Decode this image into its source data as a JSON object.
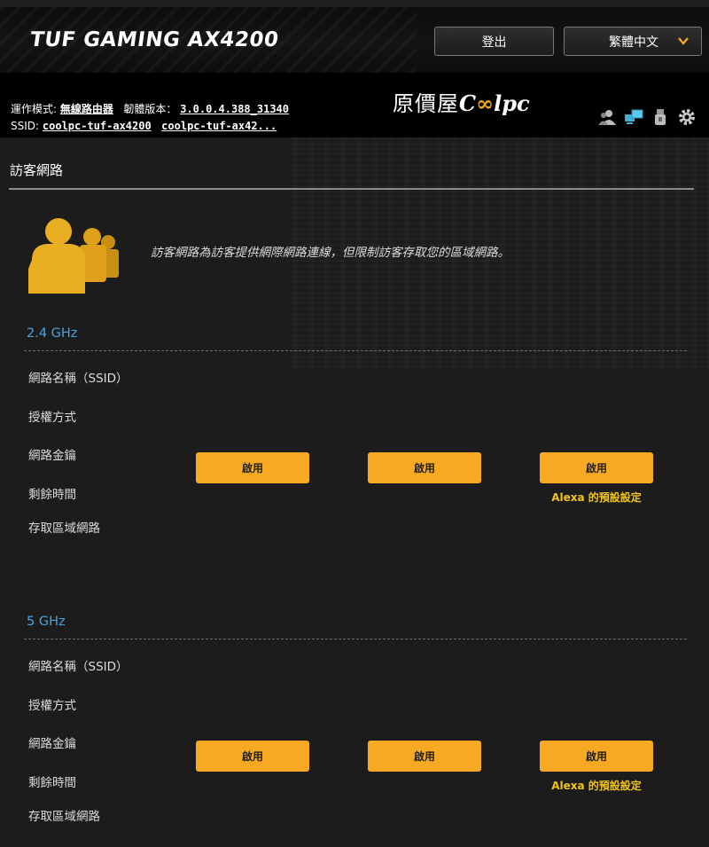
{
  "header": {
    "brand": "TUF GAMING AX4200",
    "logout_label": "登出",
    "language": "繁體中文",
    "operation_mode_label": "運作模式:",
    "operation_mode_value": "無線路由器",
    "firmware_label": "韌體版本：",
    "firmware_value": "3.0.0.4.388_31340",
    "ssid_label": "SSID:",
    "ssid_24": "coolpc-tuf-ax4200",
    "ssid_5": "coolpc-tuf-ax42...",
    "watermark_cn": "原價屋",
    "watermark_c": "C",
    "watermark_oo": "∞",
    "watermark_lpc": "lpc",
    "status_icons": [
      "client-users-icon",
      "network-map-icon",
      "usb-icon",
      "settings-gear-icon"
    ]
  },
  "page": {
    "title": "訪客網路",
    "description": "訪客網路為訪客提供網際網路連線，但限制訪客存取您的區域網路。"
  },
  "bands": [
    {
      "title": "2.4 GHz",
      "fields": [
        "網路名稱（SSID）",
        "授權方式",
        "網路金鑰",
        "剩餘時間",
        "存取區域網路"
      ],
      "buttons": [
        "啟用",
        "啟用",
        "啟用"
      ],
      "note": "Alexa 的預設設定"
    },
    {
      "title": "5 GHz",
      "fields": [
        "網路名稱（SSID）",
        "授權方式",
        "網路金鑰",
        "剩餘時間",
        "存取區域網路"
      ],
      "buttons": [
        "啟用",
        "啟用",
        "啟用"
      ],
      "note": "Alexa 的預設設定"
    }
  ],
  "colors": {
    "accent": "#f7a922",
    "band_title": "#4aa3df",
    "alexa_note": "#f0c419",
    "background": "#1c1c1c"
  }
}
